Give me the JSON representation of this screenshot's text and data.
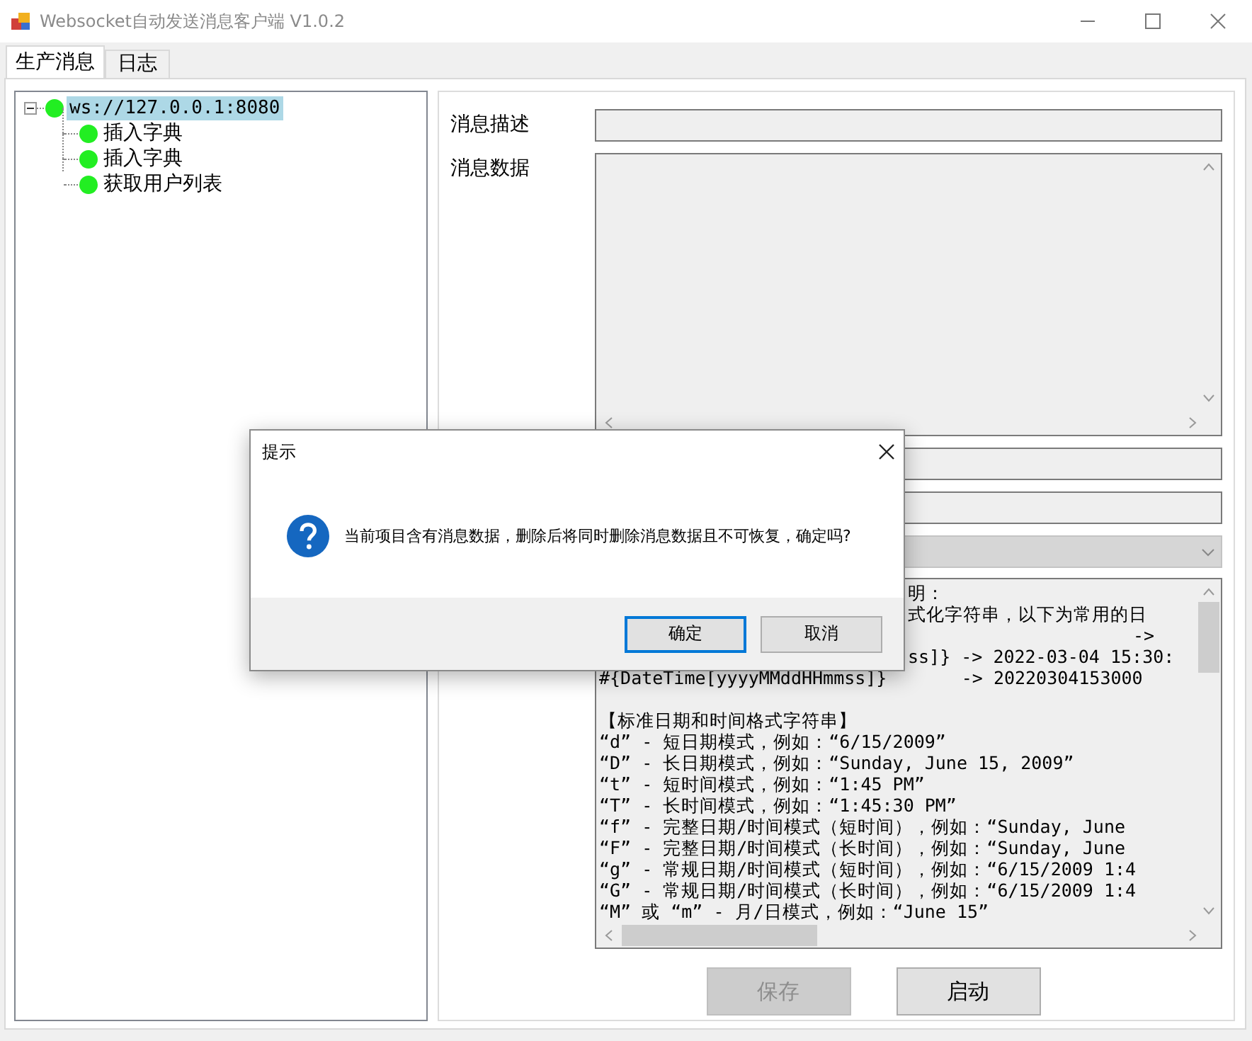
{
  "window": {
    "title": "Websocket自动发送消息客户端 V1.0.2"
  },
  "tabs": [
    {
      "label": "生产消息",
      "selected": true
    },
    {
      "label": "日志",
      "selected": false
    }
  ],
  "tree": {
    "label": "ws://127.0.0.1:8080",
    "expanded": true,
    "selected": true,
    "children": [
      {
        "label": "插入字典",
        "selected": false
      },
      {
        "label": "插入字典",
        "selected": false
      },
      {
        "label": "获取用户列表",
        "selected": false
      }
    ]
  },
  "form": {
    "fields": [
      {
        "kind": "text",
        "label": "消息描述"
      },
      {
        "kind": "textarea",
        "label": "消息数据"
      },
      {
        "kind": "text"
      },
      {
        "kind": "text"
      },
      {
        "kind": "combo"
      },
      {
        "kind": "log",
        "lines": [
          {
            "kind": "covered",
            "text": "明："
          },
          {
            "kind": "covered",
            "text": "式化字符串，以下为常用的日"
          },
          {
            "kind": "covered-right",
            "text": "->"
          },
          {
            "kind": "covered",
            "text": "ss]} -> 2022-03-04 15:30:"
          },
          {
            "kind": "plain",
            "text": "#{DateTime[yyyyMMddHHmmss]}       -> 20220304153000"
          },
          {
            "kind": "blank"
          },
          {
            "kind": "plain",
            "text": "【标准日期和时间格式字符串】"
          },
          {
            "kind": "plain",
            "text": "“d” - 短日期模式，例如：“6/15/2009”"
          },
          {
            "kind": "plain",
            "text": "“D” - 长日期模式，例如：“Sunday, June 15, 2009”"
          },
          {
            "kind": "plain",
            "text": "“t” - 短时间模式，例如：“1:45 PM”"
          },
          {
            "kind": "plain",
            "text": "“T” - 长时间模式，例如：“1:45:30 PM”"
          },
          {
            "kind": "plain",
            "text": "“f” - 完整日期/时间模式（短时间），例如：“Sunday, June"
          },
          {
            "kind": "plain",
            "text": "“F” - 完整日期/时间模式（长时间），例如：“Sunday, June"
          },
          {
            "kind": "plain",
            "text": "“g” - 常规日期/时间模式（短时间），例如：“6/15/2009 1:4"
          },
          {
            "kind": "plain",
            "text": "“G” - 常规日期/时间模式（长时间），例如：“6/15/2009 1:4"
          },
          {
            "kind": "plain",
            "text": "“M” 或 “m” - 月/日模式，例如：“June 15”"
          }
        ]
      }
    ]
  },
  "buttons": [
    {
      "label": "保存",
      "disabled": true
    },
    {
      "label": "启动",
      "disabled": false
    }
  ],
  "dialog": {
    "title": "提示",
    "message": "当前项目含有消息数据，删除后将同时删除消息数据且不可恢复，确定吗?",
    "buttons": [
      {
        "label": "确定",
        "default": true
      },
      {
        "label": "取消",
        "default": false
      }
    ]
  }
}
